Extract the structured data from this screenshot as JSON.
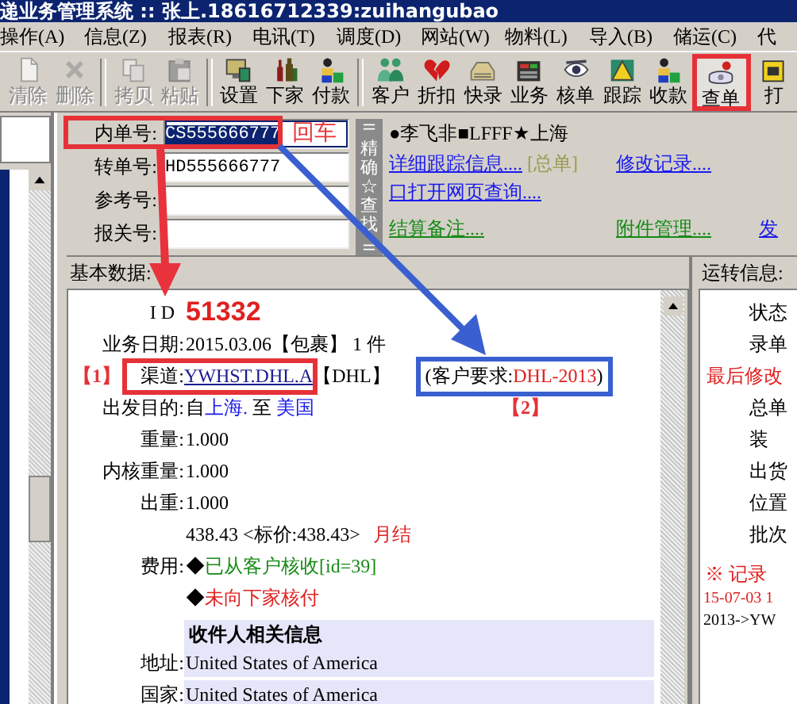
{
  "window": {
    "title": "递业务管理系统 :: 张上.18616712339:zuihangubao"
  },
  "menu": [
    "操作(A)",
    "信息(Z)",
    "报表(R)",
    "电讯(T)",
    "调度(D)",
    "网站(W)",
    "物料(L)",
    "导入(B)",
    "储运(C)",
    "代"
  ],
  "toolbar": [
    [
      {
        "label": "清除",
        "disabled": true,
        "marked": false
      },
      {
        "label": "删除",
        "disabled": true,
        "marked": false
      }
    ],
    [
      {
        "label": "拷贝",
        "disabled": true,
        "marked": false
      },
      {
        "label": "粘贴",
        "disabled": true,
        "marked": false
      }
    ],
    [
      {
        "label": "设置",
        "disabled": false,
        "marked": false
      },
      {
        "label": "下家",
        "disabled": false,
        "marked": false
      },
      {
        "label": "付款",
        "disabled": false,
        "marked": false
      }
    ],
    [
      {
        "label": "客户",
        "disabled": false,
        "marked": false
      },
      {
        "label": "折扣",
        "disabled": false,
        "marked": false
      },
      {
        "label": "快录",
        "disabled": false,
        "marked": false
      },
      {
        "label": "业务",
        "disabled": false,
        "marked": false
      },
      {
        "label": "核单",
        "disabled": false,
        "marked": false
      },
      {
        "label": "跟踪",
        "disabled": false,
        "marked": false
      },
      {
        "label": "收款",
        "disabled": false,
        "marked": false
      },
      {
        "label": "查单",
        "disabled": false,
        "marked": true
      },
      {
        "label": "打",
        "disabled": false,
        "marked": false
      }
    ]
  ],
  "search_fields": [
    {
      "label": "内单号:",
      "value": "CS555666777",
      "selected": true,
      "marked": true,
      "note": "回车"
    },
    {
      "label": "转单号:",
      "value": "HD555666777",
      "selected": false,
      "marked": false
    },
    {
      "label": "参考号:",
      "selected": false,
      "marked": false
    },
    {
      "label": "报关号:",
      "selected": false,
      "marked": false
    }
  ],
  "exact_search_button": "精确☆查找",
  "summary": "●李飞非■LFFF★上海",
  "link_rows": [
    {
      "cells": [
        [
          {
            "text": "详细跟踪信息....",
            "kind": "link"
          },
          {
            "text": "[总单]",
            "kind": "tag"
          }
        ],
        [
          {
            "text": "修改记录....",
            "kind": "link"
          }
        ]
      ]
    },
    {
      "cells": [
        [
          {
            "text": "口打开网页查询....",
            "kind": "link"
          }
        ]
      ]
    },
    {
      "cells": [
        [
          {
            "text": "结算备注....",
            "kind": "note"
          }
        ],
        [
          {
            "text": "附件管理....",
            "kind": "note"
          }
        ],
        [
          {
            "text": "发",
            "kind": "link"
          }
        ]
      ]
    }
  ],
  "basic_data": {
    "heading": "基本数据:",
    "id_label": "I D",
    "id": "51332",
    "date_label": "业务日期:",
    "date_value": "2015.03.06【包裹】 1 件",
    "channel": {
      "marker": "【1】",
      "label": "渠道:",
      "value": "YWHST.DHL.A",
      "carrier": "【DHL】",
      "marked": true,
      "request": {
        "prefix": "(客户要求:",
        "code": "DHL-2013",
        "suffix": ")",
        "marked": true
      },
      "marker2": "【2】"
    },
    "route": {
      "label": "出发目的:",
      "prefix": "自",
      "from": "上海.",
      "middle": "至",
      "to": "美国"
    },
    "weights": [
      {
        "label": "重量:",
        "value": "1.000"
      },
      {
        "label": "内核重量:",
        "value": "1.000"
      },
      {
        "label": "出重:",
        "value": "1.000"
      }
    ],
    "fees": {
      "label": "费用:",
      "amount": "438.43 <标价:438.43>",
      "terms": "月结",
      "lines": [
        {
          "mark": "◆",
          "text": "已从客户核收[id=39]",
          "done": true
        },
        {
          "mark": "◆",
          "text": "未向下家核付",
          "done": false
        }
      ]
    },
    "recipient": {
      "heading": "收件人相关信息",
      "rows": [
        {
          "label": "地址:",
          "value": "United States of America"
        },
        {
          "label": "国家:",
          "value": "United States of America"
        }
      ]
    }
  },
  "transit": {
    "heading": "运转信息:",
    "lines": [
      {
        "text": "状态",
        "kind": "label"
      },
      {
        "text": "录单",
        "kind": "label"
      },
      {
        "text": "最后修改",
        "kind": "alert"
      },
      {
        "text": "总单",
        "kind": "label"
      },
      {
        "text": "装",
        "kind": "label"
      },
      {
        "text": "出货",
        "kind": "label"
      },
      {
        "text": "位置",
        "kind": "label"
      },
      {
        "text": "批次",
        "kind": "label"
      }
    ],
    "log_title": "※ 记录",
    "log": [
      {
        "text": "15-07-03 1",
        "kind": "alert"
      },
      {
        "text": "2013->YW",
        "kind": "plain"
      }
    ]
  },
  "annotation_arrows": [
    {
      "color": "#e8323c"
    },
    {
      "color": "#3a5fd0"
    }
  ]
}
